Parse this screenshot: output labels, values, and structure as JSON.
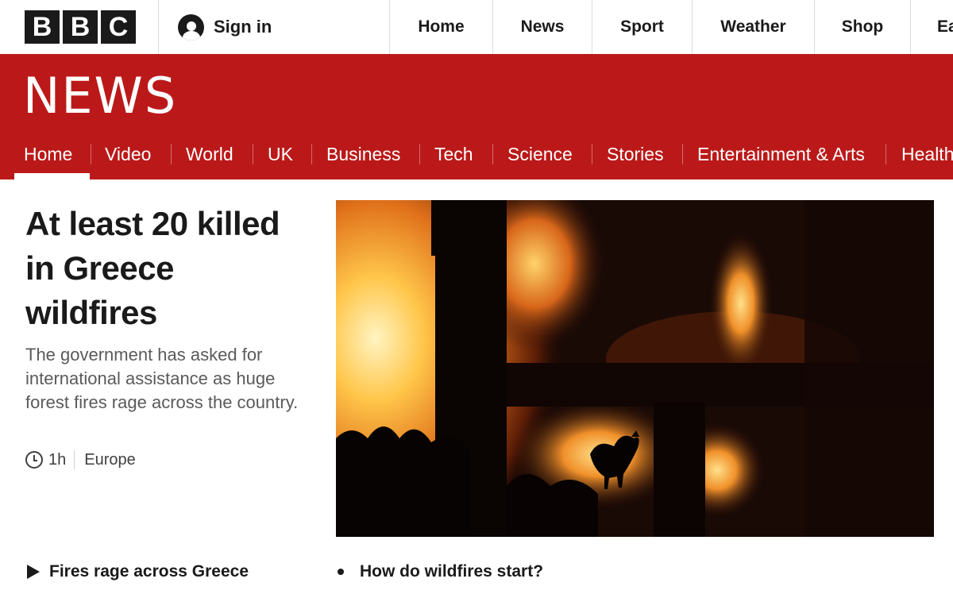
{
  "global_header": {
    "logo": [
      "B",
      "B",
      "C"
    ],
    "sign_in": "Sign in",
    "nav": [
      "Home",
      "News",
      "Sport",
      "Weather",
      "Shop",
      "Ea"
    ]
  },
  "news_banner": {
    "wordmark": "NEWS",
    "sections": [
      "Home",
      "Video",
      "World",
      "UK",
      "Business",
      "Tech",
      "Science",
      "Stories",
      "Entertainment & Arts",
      "Health"
    ],
    "active_section": "Home"
  },
  "top_story": {
    "headline": "At least 20 killed in Greece wildfires",
    "summary": "The government has asked for international assistance as huge forest fires rage across the country.",
    "time": "1h",
    "region": "Europe"
  },
  "related": [
    {
      "label": "Fires rage across Greece",
      "icon": "play-icon"
    },
    {
      "label": "How do wildfires start?",
      "icon": "bullet-icon"
    }
  ],
  "colors": {
    "brand_red": "#bb1919",
    "text_dark": "#1a1a1a",
    "summary_grey": "#5a5a5a"
  }
}
